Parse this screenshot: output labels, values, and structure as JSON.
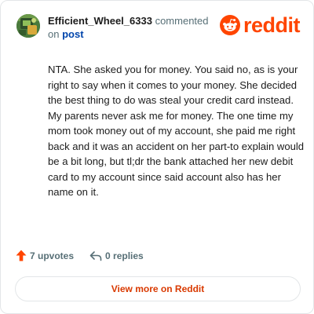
{
  "header": {
    "username": "Efficient_Wheel_6333",
    "action_text": "commented",
    "preposition": "on",
    "post_link": "post"
  },
  "brand": {
    "wordmark": "reddit",
    "icon": "reddit-snoo-icon",
    "color": "#ff4500"
  },
  "comment": {
    "body": "NTA. She asked you for money. You said no, as is your right to say when it comes to your money. She decided the best thing to do was steal your credit card instead. My parents never ask me for money. The one time my mom took money out of my account, she paid me right back and it was an accident on her part-to explain would be a bit long, but tl;dr the bank attached her new debit card to my account since said account also has her name on it."
  },
  "actions": {
    "upvotes_label": "7 upvotes",
    "upvote_icon": "upvote-arrow-icon",
    "upvote_color": "#ff4500",
    "replies_label": "0 replies",
    "reply_icon": "reply-icon"
  },
  "footer": {
    "view_more_label": "View more on Reddit",
    "accent_color": "#d93900"
  }
}
